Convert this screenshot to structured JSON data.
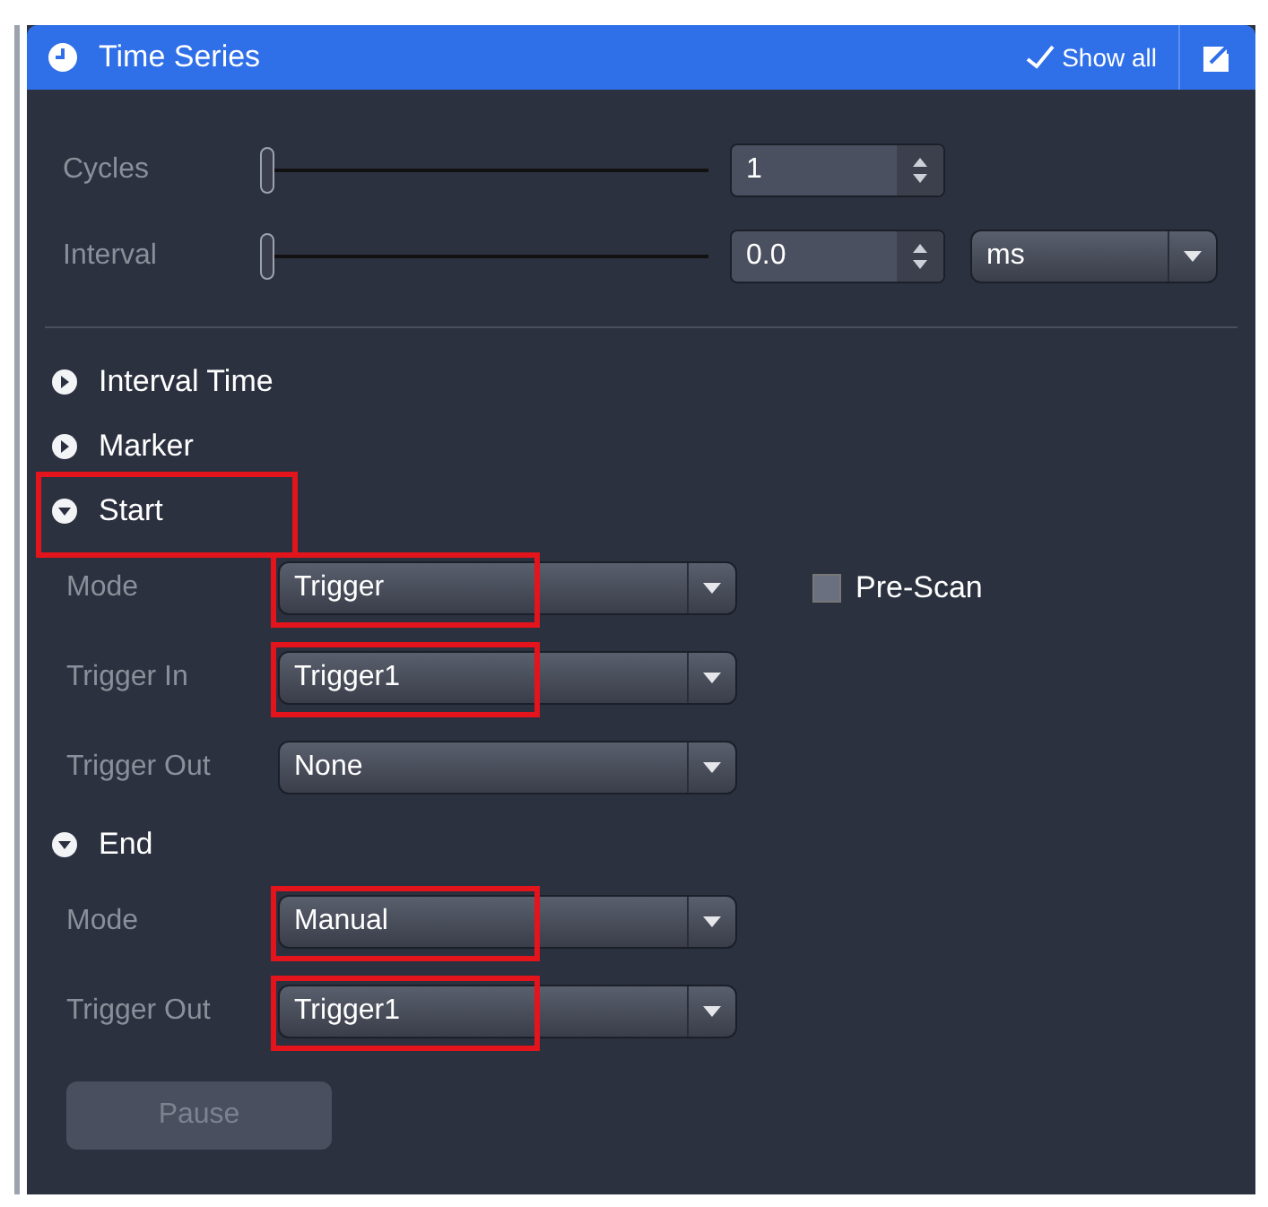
{
  "panel": {
    "title": "Time Series",
    "show_all": {
      "label": "Show all",
      "checked": true
    }
  },
  "sliders": [
    {
      "label": "Cycles",
      "level": 0,
      "value": "1"
    },
    {
      "label": "Interval",
      "level": 0,
      "value": "0.0",
      "unit": "ms"
    }
  ],
  "sections": [
    {
      "title": "Interval Time",
      "expanded": false
    },
    {
      "title": "Marker",
      "expanded": false
    },
    {
      "title": "Start",
      "expanded": true,
      "highlighted": true,
      "fields": [
        {
          "label": "Mode",
          "value": "Trigger",
          "highlighted": true,
          "checkbox": {
            "label": "Pre-Scan",
            "checked": false
          }
        },
        {
          "label": "Trigger In",
          "value": "Trigger1",
          "highlighted": true
        },
        {
          "label": "Trigger Out",
          "value": "None"
        }
      ]
    },
    {
      "title": "End",
      "expanded": true,
      "fields": [
        {
          "label": "Mode",
          "value": "Manual",
          "highlighted": true
        },
        {
          "label": "Trigger Out",
          "value": "Trigger1",
          "highlighted": true
        }
      ]
    }
  ],
  "pause_button": {
    "label": "Pause",
    "disabled": true
  }
}
